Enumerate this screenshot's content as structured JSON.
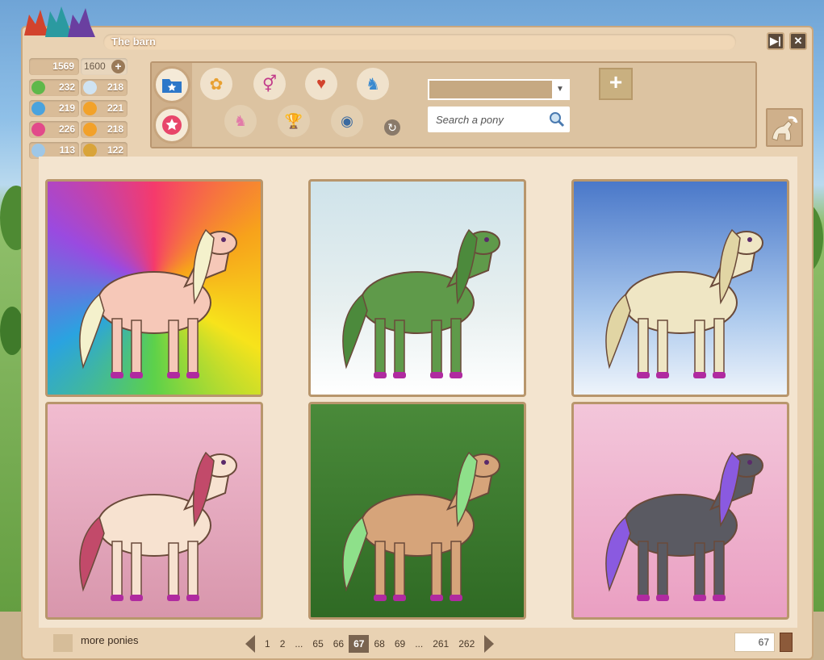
{
  "window": {
    "title": "The barn"
  },
  "stats": {
    "resource": "1569",
    "capacity": "1600",
    "items": [
      {
        "icon": "apple-icon",
        "color": "#5fb84a",
        "value": "232"
      },
      {
        "icon": "cloud-icon",
        "color": "#cfe3f2",
        "value": "218"
      },
      {
        "icon": "paw-blue-icon",
        "color": "#4aa3de",
        "value": "219"
      },
      {
        "icon": "flame-icon",
        "color": "#f2a22a",
        "value": "221"
      },
      {
        "icon": "heart-icon",
        "color": "#e24a8a",
        "value": "226"
      },
      {
        "icon": "paw-orange-icon",
        "color": "#f2a12a",
        "value": "218"
      },
      {
        "icon": "magnifier-icon",
        "color": "#9fc7e6",
        "value": "113"
      },
      {
        "icon": "hay-icon",
        "color": "#d9a43a",
        "value": "122"
      }
    ]
  },
  "filters": {
    "search_placeholder": "Search a pony",
    "dropdown_value": ""
  },
  "cards": [
    {
      "name": "pony-card-rainbow",
      "bg": "conic-gradient(from 0deg, #f53a6c, #f7a21b, #f7e31b, #5dd14a, #2aa3e0, #9a4ae0, #f53a6c)",
      "body": "#f6c8b8",
      "mane": "#f4f1cc"
    },
    {
      "name": "pony-card-forest-unicorn",
      "bg": "linear-gradient(#cfe3ea, #e8f0f0 60%, #ffffff)",
      "body": "#5f9a4a",
      "mane": "#4c8a3c"
    },
    {
      "name": "pony-card-pegasus-sky",
      "bg": "linear-gradient(#4a78c9, #a7c6ec 60%, #eef4fb)",
      "body": "#efe6c4",
      "mane": "#e1d5a4"
    },
    {
      "name": "pony-card-pink-pegasus",
      "bg": "linear-gradient(#f1bcd0, #d896ac)",
      "body": "#f7e2d0",
      "mane": "#c24a6a"
    },
    {
      "name": "pony-card-mushroom-forest",
      "bg": "linear-gradient(#4a8a3a, #2f6a24)",
      "body": "#d6a47a",
      "mane": "#8ee08a"
    },
    {
      "name": "pony-card-night-unicorn",
      "bg": "linear-gradient(#f3c6da, #ea9fc2)",
      "body": "#5a5a62",
      "mane": "#8a5ae0"
    }
  ],
  "pagination": {
    "more_label": "more ponies",
    "pages": [
      "1",
      "2",
      "...",
      "65",
      "66",
      "67",
      "68",
      "69",
      "...",
      "261",
      "262"
    ],
    "current": "67",
    "input_value": "67"
  }
}
